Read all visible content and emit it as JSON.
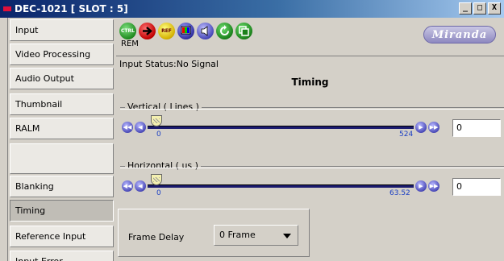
{
  "window": {
    "title": "DEC-1021 [ SLOT : 5]",
    "minimize": "_",
    "maximize": "□",
    "close": "X"
  },
  "sidebar": {
    "items": [
      {
        "label": "Input"
      },
      {
        "label": "Video Processing"
      },
      {
        "label": "Audio Output"
      },
      {
        "label": "Thumbnail"
      },
      {
        "label": "RALM"
      },
      {
        "label": ""
      },
      {
        "label": "Blanking"
      },
      {
        "label": "Timing"
      },
      {
        "label": "Reference Input"
      },
      {
        "label": "Input Error"
      }
    ],
    "active": "Timing"
  },
  "toolbar": {
    "icons": [
      "ctrl-icon",
      "arrow-icon",
      "ref-icon",
      "monitor-icon",
      "audio-icon",
      "refresh-icon",
      "copy-icon"
    ],
    "ctrl_label": "CTRL",
    "ref_label": "REF",
    "rem_label": "REM",
    "logo": "Miranda"
  },
  "status": {
    "text": "Input Status:No Signal"
  },
  "timing": {
    "title": "Timing",
    "vertical": {
      "label": "Vertical ( Lines )",
      "min": "0",
      "max": "524",
      "value": "0"
    },
    "horizontal": {
      "label": "Horizontal ( us )",
      "min": "0",
      "max": "63.52",
      "value": "0"
    },
    "frame_delay": {
      "label": "Frame Delay",
      "value": "0 Frame"
    }
  },
  "colors": {
    "title_bar": "#0a246a",
    "slider_track": "#1a1a6e",
    "tick_text": "#1b3fc4"
  }
}
